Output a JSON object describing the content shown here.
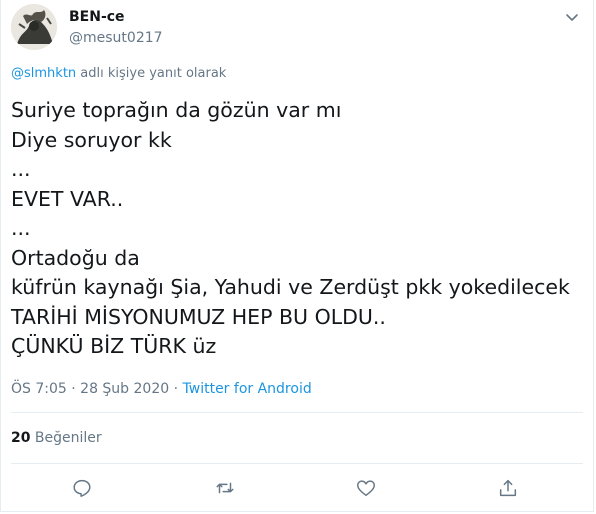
{
  "user": {
    "name": "BEN-ce",
    "handle": "@mesut0217"
  },
  "reply": {
    "mention": "@slmhktn",
    "suffix": " adlı kişiye yanıt olarak"
  },
  "tweet": {
    "text": "Suriye toprağın da gözün var mı\nDiye soruyor kk\n...\nEVET VAR..\n...\nOrtadoğu da\nküfrün kaynağı Şia, Yahudi ve Zerdüşt pkk yokedilecek\nTARİHİ MİSYONUMUZ HEP BU OLDU..\nÇÜNKÜ BİZ TÜRK üz"
  },
  "meta": {
    "time": "ÖS 7:05",
    "separator": " · ",
    "date": "28 Şub 2020",
    "source": "Twitter for Android"
  },
  "stats": {
    "likes_count": "20",
    "likes_label": " Beğeniler"
  },
  "icons": {
    "caret": "chevron-down-icon",
    "reply": "reply-icon",
    "retweet": "retweet-icon",
    "like": "heart-icon",
    "share": "share-icon"
  },
  "colors": {
    "text": "#14171a",
    "secondary": "#657786",
    "link": "#1b95e0",
    "border": "#e6ecf0"
  }
}
